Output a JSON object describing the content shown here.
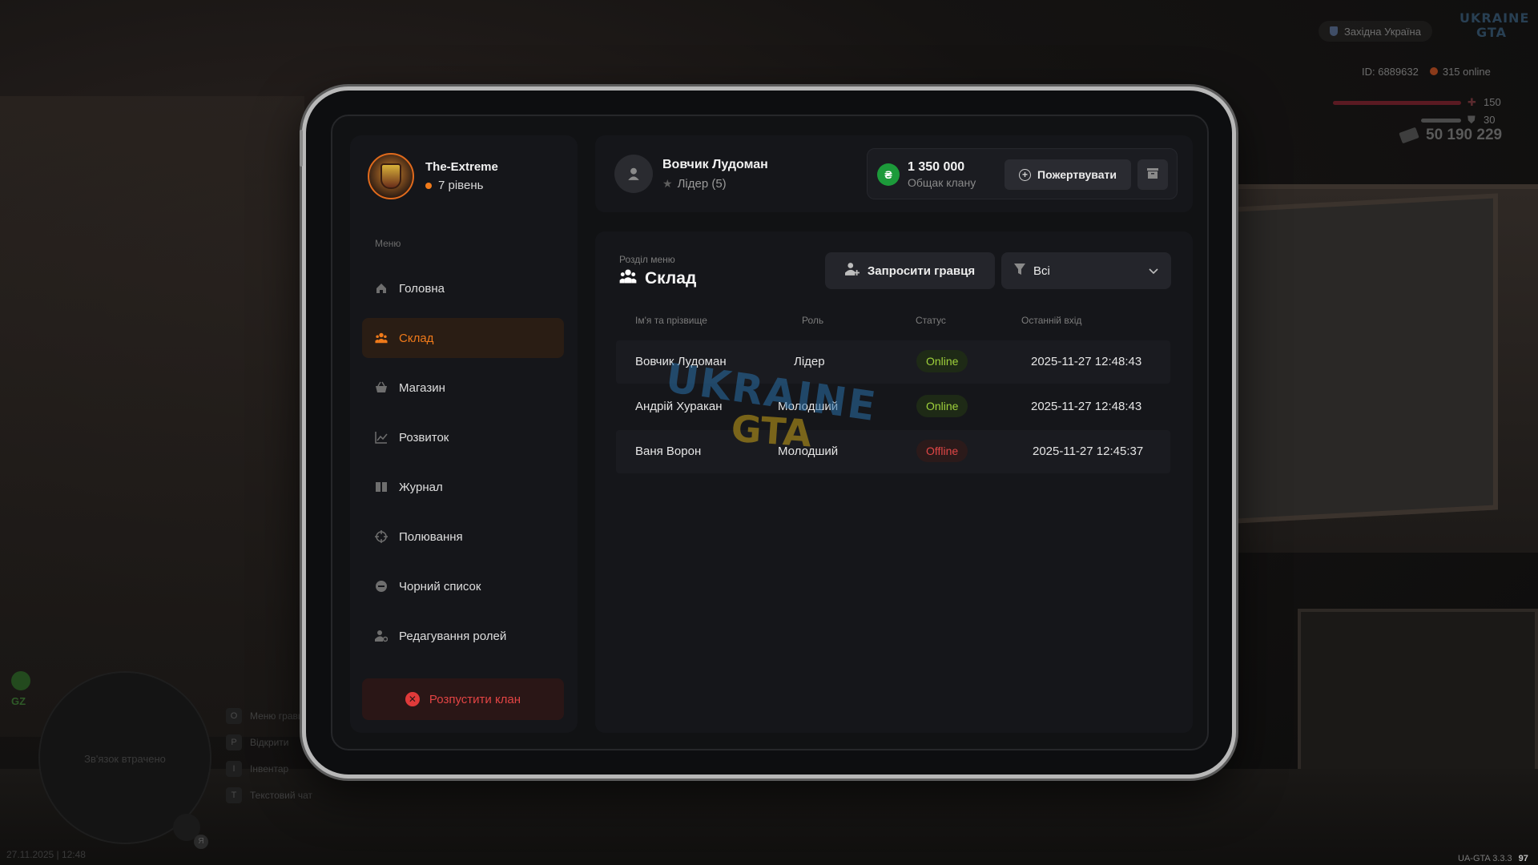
{
  "hud": {
    "server_name": "Західна Україна",
    "logo_text": "UKRAINE GTA",
    "player_id": "ID: 6889632",
    "online": "315 online",
    "health": "150",
    "armor": "30",
    "money": "50 190 229",
    "minimap_status": "Зв'язок втрачено",
    "gz_label": "GZ",
    "hints": [
      {
        "key": "O",
        "label": "Меню гравця"
      },
      {
        "key": "P",
        "label": "Відкрити"
      },
      {
        "key": "I",
        "label": "Інвентар"
      },
      {
        "key": "T",
        "label": "Текстовий чат"
      }
    ],
    "mic_key": "Я",
    "datetime": "27.11.2025 | 12:48",
    "version": "UA-GTA 3.3.3",
    "fps": "97"
  },
  "clan": {
    "name": "The-Extreme",
    "level": "7 рівень"
  },
  "sidebar": {
    "menu_caption": "Меню",
    "items": [
      {
        "label": "Головна",
        "icon": "home-icon"
      },
      {
        "label": "Склад",
        "icon": "people-icon",
        "active": true
      },
      {
        "label": "Магазин",
        "icon": "basket-icon"
      },
      {
        "label": "Розвиток",
        "icon": "chart-icon"
      },
      {
        "label": "Журнал",
        "icon": "book-icon"
      },
      {
        "label": "Полювання",
        "icon": "crosshair-icon"
      },
      {
        "label": "Чорний список",
        "icon": "minus-circle-icon"
      },
      {
        "label": "Редагування ролей",
        "icon": "user-gear-icon"
      }
    ],
    "disband_label": "Розпустити клан"
  },
  "header": {
    "user_name": "Вовчик Лудоман",
    "user_role": "Лідер (5)",
    "bank_amount": "1 350 000",
    "bank_label": "Общак клану",
    "bank_currency": "₴",
    "donate_label": "Пожертвувати"
  },
  "main": {
    "section_caption": "Розділ меню",
    "section_title": "Склад",
    "invite_label": "Запросити гравця",
    "filter_value": "Всі",
    "columns": [
      "Ім'я та прізвище",
      "Роль",
      "Статус",
      "Останній вхід"
    ],
    "members": [
      {
        "name": "Вовчик Лудоман",
        "role": "Лідер",
        "status": "Online",
        "last_login": "2025-11-27 12:48:43"
      },
      {
        "name": "Андрій Хуракан",
        "role": "Молодший",
        "status": "Online",
        "last_login": "2025-11-27 12:48:43"
      },
      {
        "name": "Ваня Ворон",
        "role": "Молодший",
        "status": "Offline",
        "last_login": "2025-11-27 12:45:37"
      }
    ],
    "watermark_line1": "UKRAINE",
    "watermark_line2": "GTA"
  },
  "colors": {
    "accent": "#f07a1a",
    "online": "#9fd13b",
    "offline": "#e04646",
    "bank_coin": "#1c9a3a"
  }
}
